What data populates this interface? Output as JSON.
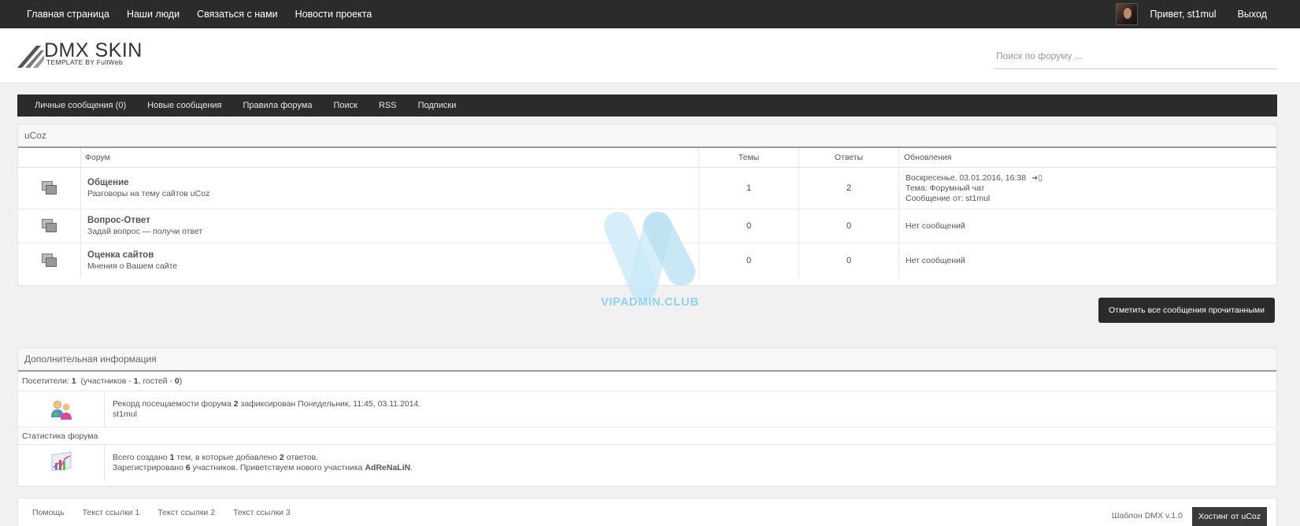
{
  "topnav": {
    "items": [
      "Главная страница",
      "Наши люди",
      "Связаться с нами",
      "Новости проекта"
    ],
    "greeting": "Привет, st1mul",
    "logout": "Выход"
  },
  "header": {
    "logo_title": "DMX SKIN",
    "logo_sub": "TEMPLATE BY FullWeb",
    "search_placeholder": "Поиск по форуму ..."
  },
  "menu": {
    "items": [
      "Личные сообщения (0)",
      "Новые сообщения",
      "Правила форума",
      "Поиск",
      "RSS",
      "Подписки"
    ]
  },
  "forum": {
    "category": "uCoz",
    "columns": {
      "forum": "Форум",
      "topics": "Темы",
      "replies": "Ответы",
      "updates": "Обновления"
    },
    "rows": [
      {
        "name": "Общение",
        "desc": "Разговоры на тему сайтов uCoz",
        "topics": "1",
        "replies": "2",
        "update_line1": "Воскресенье, 03.01.2016, 16:38",
        "update_line2": "Тема: Форумный чат",
        "update_line3": "Сообщение от: st1mul"
      },
      {
        "name": "Вопрос-Ответ",
        "desc": "Задай вопрос — получи ответ",
        "topics": "0",
        "replies": "0",
        "update_line1": "Нет сообщений"
      },
      {
        "name": "Оценка сайтов",
        "desc": "Мнения о Вашем сайте",
        "topics": "0",
        "replies": "0",
        "update_line1": "Нет сообщений"
      }
    ]
  },
  "mark_all_button": "Отметить все сообщения прочитанными",
  "info": {
    "title": "Дополнительная информация",
    "visitors_label": "Посетители:",
    "visitors_count": "1",
    "visitors_detail_prefix": "(участников -",
    "members_count": "1",
    "guests_label": ", гостей -",
    "guests_count": "0",
    "record_prefix": "Рекорд посещаемости форума",
    "record_count": "2",
    "record_suffix": "зафиксирован Понедельник, 11:45, 03.11.2014.",
    "online_user": "st1mul",
    "stats_title": "Статистика форума",
    "stats_created_prefix": "Всего создано",
    "stats_topics": "1",
    "stats_created_mid": "тем, в которые добавлено",
    "stats_replies": "2",
    "stats_created_suffix": "ответов.",
    "stats_reg_prefix": "Зарегистрировано",
    "stats_members": "6",
    "stats_reg_mid": "участников. Приветствуем нового участника",
    "new_member": "AdReNaLiN"
  },
  "footer": {
    "links": [
      "Помощь",
      "Текст ссылки 1",
      "Текст ссылки 2",
      "Текст ссылки 3"
    ],
    "version": "Шаблон DMX v.1.0",
    "hosting": "Хостинг от uCoz"
  },
  "watermark": "VIPADMIN.CLUB"
}
